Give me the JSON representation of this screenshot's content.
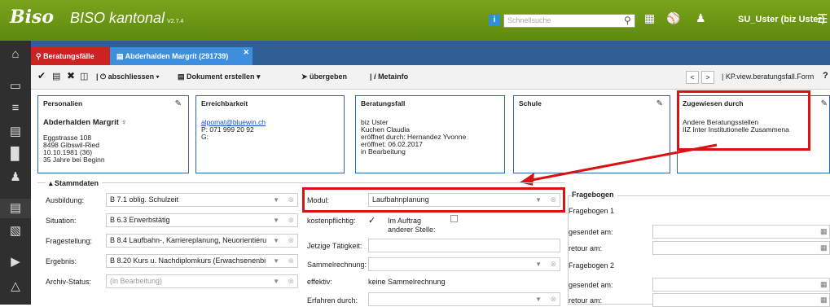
{
  "header": {
    "logo": "Biso",
    "app_title": "BISO kantonal",
    "version": "V2.7.4",
    "search_placeholder": "Schnellsuche",
    "user": "SU_Uster (biz Uster)"
  },
  "tabs": {
    "tab1": "Beratungsfälle",
    "tab2": "Abderhalden Margrit (291739)"
  },
  "toolbar": {
    "abschliessen": "abschliessen",
    "dokument": "Dokument erstellen",
    "uebergeben": "übergeben",
    "metainfo": "Metainfo",
    "nav_prev": "<",
    "nav_next": ">",
    "view_name": "KP.view.beratungsfall.Form",
    "help": "?"
  },
  "cards": {
    "personalien": {
      "title": "Personalien",
      "name": "Abderhalden Margrit",
      "lines": [
        "Eggstrasse 108",
        "8498 Gibswil-Ried",
        "10.10.1981 (36)",
        "35 Jahre bei Beginn"
      ]
    },
    "erreichbarkeit": {
      "title": "Erreichbarkeit",
      "email": "alpomat@bluewin.ch",
      "phone": "P: 071 999 20 92",
      "g": "G:"
    },
    "beratungsfall": {
      "title": "Beratungsfall",
      "lines": [
        "biz Uster",
        "Kuchen Claudia",
        "eröffnet durch: Hernandez Yvonne",
        "eröffnet: 06.02.2017",
        "in Bearbeitung"
      ]
    },
    "schule": {
      "title": "Schule"
    },
    "zugewiesen": {
      "title": "Zugewiesen durch",
      "lines": [
        "Andere Beratungsstellen",
        "IIZ Inter Institutionelle Zusammena"
      ]
    }
  },
  "stammdaten": {
    "legend": "Stammdaten",
    "ausbildung_label": "Ausbildung:",
    "ausbildung_value": "B 7.1 oblig. Schulzeit",
    "situation_label": "Situation:",
    "situation_value": "B 6.3 Erwerbstätig",
    "fragestellung_label": "Fragestellung:",
    "fragestellung_value": "B 8.4 Laufbahn-, Karriereplanung, Neuorientieru",
    "ergebnis_label": "Ergebnis:",
    "ergebnis_value": "B 8.20 Kurs u. Nachdiplomkurs (Erwachsenenbi",
    "archiv_label": "Archiv-Status:",
    "archiv_value": "(in Bearbeitung)",
    "modul_label": "Modul:",
    "modul_value": "Laufbahnplanung",
    "kostenpflichtig_label": "kostenpflichtig:",
    "im_auftrag_label": "Im Auftrag",
    "anderer_stelle_label": "anderer Stelle:",
    "taetigkeit_label": "Jetzige Tätigkeit:",
    "sammelrechnung_label": "Sammelrechnung:",
    "effektiv_label": "effektiv:",
    "effektiv_value": "keine Sammelrechnung",
    "erfahren_label": "Erfahren durch:"
  },
  "fragebogen": {
    "legend": "Fragebogen",
    "fb1": "Fragebogen 1",
    "gesendet1": "gesendet am:",
    "retour1": "retour am:",
    "fb2": "Fragebogen 2",
    "gesendet2": "gesendet am:",
    "retour2": "retour am:"
  },
  "colors": {
    "header_green": "#6a961a",
    "tab_bar": "#2f5f94",
    "tab_active_red": "#cc2222",
    "tab_blue": "#3d8fde",
    "highlight_red": "#dd1111",
    "card_border": "#2e66a6"
  }
}
